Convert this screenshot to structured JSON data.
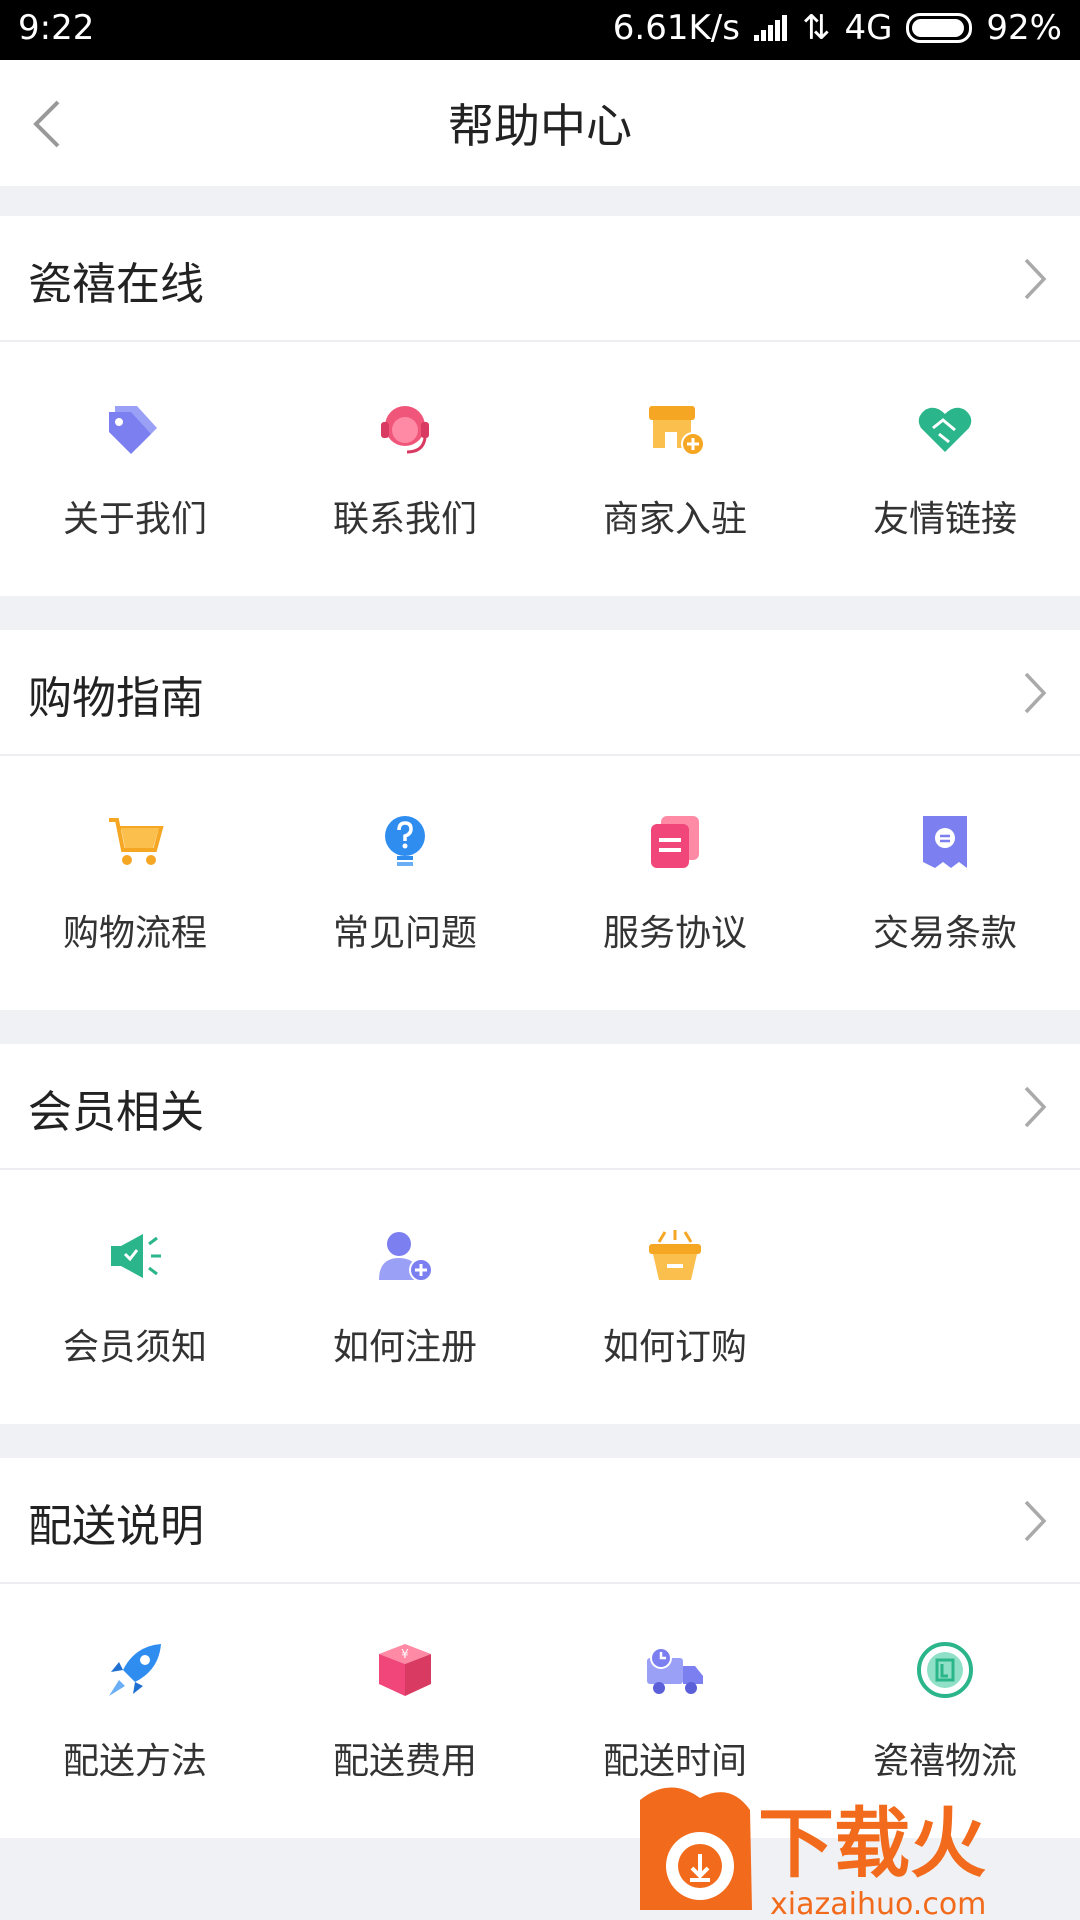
{
  "status": {
    "time": "9:22",
    "speed": "6.61K/s",
    "network": "4G",
    "battery": "92%"
  },
  "header": {
    "title": "帮助中心"
  },
  "sections": [
    {
      "title": "瓷禧在线",
      "items": [
        {
          "label": "关于我们",
          "icon": "tag-icon",
          "color": "#7b7ff0"
        },
        {
          "label": "联系我们",
          "icon": "headset-icon",
          "color": "#f0567a"
        },
        {
          "label": "商家入驻",
          "icon": "shop-add-icon",
          "color": "#f5a623"
        },
        {
          "label": "友情链接",
          "icon": "handshake-icon",
          "color": "#2bb58a"
        }
      ]
    },
    {
      "title": "购物指南",
      "items": [
        {
          "label": "购物流程",
          "icon": "cart-icon",
          "color": "#f5a623"
        },
        {
          "label": "常见问题",
          "icon": "lightbulb-question-icon",
          "color": "#2f8df0"
        },
        {
          "label": "服务协议",
          "icon": "documents-icon",
          "color": "#f0467a"
        },
        {
          "label": "交易条款",
          "icon": "receipt-icon",
          "color": "#7b7ff0"
        }
      ]
    },
    {
      "title": "会员相关",
      "items": [
        {
          "label": "会员须知",
          "icon": "megaphone-icon",
          "color": "#2bb58a"
        },
        {
          "label": "如何注册",
          "icon": "user-add-icon",
          "color": "#7b7ff0"
        },
        {
          "label": "如何订购",
          "icon": "basket-icon",
          "color": "#f5a623"
        }
      ]
    },
    {
      "title": "配送说明",
      "items": [
        {
          "label": "配送方法",
          "icon": "rocket-icon",
          "color": "#2f8df0"
        },
        {
          "label": "配送费用",
          "icon": "money-box-icon",
          "color": "#f0467a"
        },
        {
          "label": "配送时间",
          "icon": "delivery-truck-icon",
          "color": "#7b7ff0"
        },
        {
          "label": "瓷禧物流",
          "icon": "logistics-icon",
          "color": "#2bb58a"
        }
      ]
    }
  ],
  "watermark": {
    "brand": "下载火",
    "domain": "xiazaihuo.com"
  }
}
